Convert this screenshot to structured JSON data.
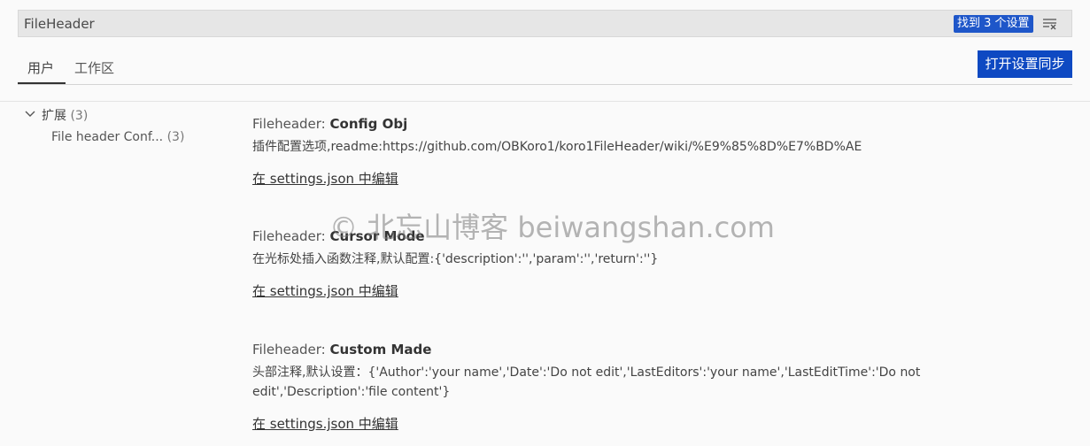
{
  "search": {
    "value": "FileHeader",
    "results_badge": "找到 3 个设置"
  },
  "tabs": [
    {
      "label": "用户",
      "active": true
    },
    {
      "label": "工作区",
      "active": false
    }
  ],
  "sync_button_label": "打开设置同步",
  "tree": {
    "group": {
      "label": "扩展",
      "count": "(3)"
    },
    "items": [
      {
        "label": "File header Conf...",
        "count": "(3)"
      }
    ]
  },
  "settings": [
    {
      "category": "Fileheader: ",
      "name": "Config Obj",
      "description": "插件配置选项,readme:https://github.com/OBKoro1/koro1FileHeader/wiki/%E9%85%8D%E7%BD%AE",
      "link": "在 settings.json 中编辑"
    },
    {
      "category": "Fileheader: ",
      "name": "Cursor Mode",
      "description": "在光标处插入函数注释,默认配置:{'description':'','param':'','return':''}",
      "link": "在 settings.json 中编辑"
    },
    {
      "category": "Fileheader: ",
      "name": "Custom Made",
      "description": "头部注释,默认设置：{'Author':'your name','Date':'Do not edit','LastEditors':'your name','LastEditTime':'Do not edit','Description':'file content'}",
      "link": "在 settings.json 中编辑"
    }
  ],
  "watermark": "© 北忘山博客 beiwangshan.com",
  "colors": {
    "accent": "#0e49c2",
    "badge": "#1e56c9",
    "background": "#fafafa",
    "search_background": "#e6e6e6"
  },
  "icons": {
    "clear_filters": "clear-filter-icon",
    "chevron": "chevron-down-icon"
  }
}
